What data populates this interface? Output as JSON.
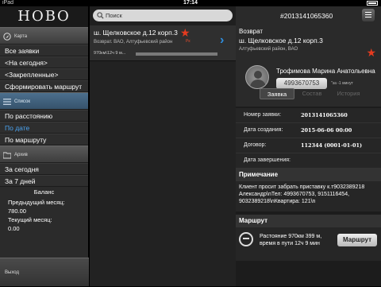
{
  "status": {
    "carrier": "iPad",
    "time": "17:14"
  },
  "sidebar": {
    "logo": "НОВО",
    "map_label": "Карта",
    "items_top": [
      "Все заявки",
      "<На сегодня>",
      "<Закрепленные>",
      "Сформировать маршрут"
    ],
    "list_label": "Список",
    "sort_items": [
      "По расстоянию",
      "По дате",
      "По маршруту"
    ],
    "selected_sort": "По дате",
    "archive_label": "Архив",
    "archive_items": [
      "За сегодня",
      "За 7 дней"
    ],
    "balance": {
      "title": "Баланс",
      "prev_label": "Предыдущий месяц:",
      "prev_value": "780.00",
      "cur_label": "Текущий месяц:",
      "cur_value": "0.00"
    },
    "logout_label": "Выход",
    "accent": "#4aa3f0"
  },
  "list": {
    "search_placeholder": "Поиск",
    "order": {
      "address": "ш. Щелковское д.12 корп.3",
      "region": "Возврат. ВАО, Алтуфьевский район",
      "tag": "Рк",
      "distance": "970км\\12ч 9 м..."
    }
  },
  "detail": {
    "number": "#2013141065360",
    "type": "Возврат",
    "address": "ш. Щелковское д.12 корп.3",
    "region": "Алтуфьевский район, ВАО",
    "driver_name": "Трофимова Марина Анатольевна",
    "driver_phone": "4993670753",
    "eta": "\"за -1 минут",
    "tabs": [
      "Заявка",
      "Состав",
      "История"
    ],
    "fields": [
      {
        "label": "Номер заявки:",
        "value": "2013141065360"
      },
      {
        "label": "Дата создания:",
        "value": "2015-06-06 00:00"
      },
      {
        "label": "Договор:",
        "value": "112344 (0001-01-01)"
      },
      {
        "label": "Дата завершения:",
        "value": ""
      }
    ],
    "note_title": "Примечание",
    "note_text": "Клиент просит забрать приставку к.т9032389218 Александр\\nТел: 4993670753, 9151116454, 9032389218\\nКвартира: 121\\n",
    "route_title": "Маршрут",
    "route_line1": "Растояние 970км 399 м,",
    "route_line2": "время в пути 12ч 9 мин",
    "route_button": "Маршрут",
    "star_color": "#e43b1f"
  }
}
